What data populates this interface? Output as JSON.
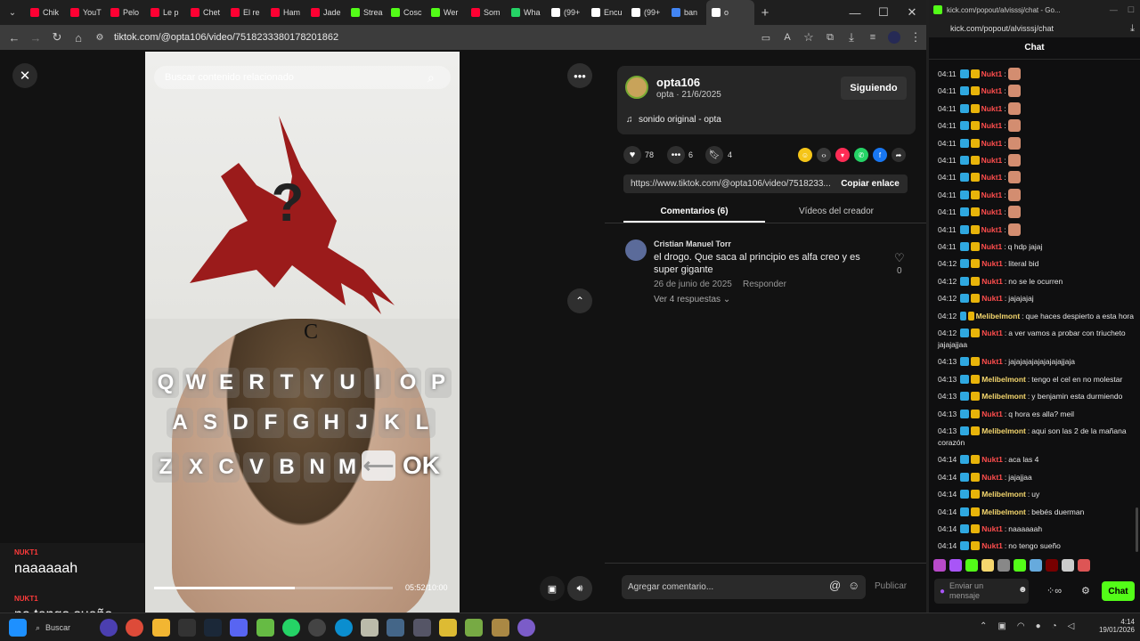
{
  "browser": {
    "tabs": [
      {
        "label": "Chik",
        "color": "#ff0033"
      },
      {
        "label": "YouT",
        "color": "#ff0033"
      },
      {
        "label": "Pelo",
        "color": "#ff0033"
      },
      {
        "label": "Le p",
        "color": "#ff0033"
      },
      {
        "label": "Chet",
        "color": "#ff0033"
      },
      {
        "label": "El re",
        "color": "#ff0033"
      },
      {
        "label": "Ham",
        "color": "#ff0033"
      },
      {
        "label": "Jade",
        "color": "#ff0033"
      },
      {
        "label": "Strea",
        "color": "#53fc18"
      },
      {
        "label": "Cosc",
        "color": "#53fc18"
      },
      {
        "label": "Wer",
        "color": "#53fc18"
      },
      {
        "label": "Som",
        "color": "#ff0033"
      },
      {
        "label": "Wha",
        "color": "#25d366"
      },
      {
        "label": "(99+",
        "color": "#ffffff"
      },
      {
        "label": "Encu",
        "color": "#ffffff"
      },
      {
        "label": "(99+",
        "color": "#ffffff"
      },
      {
        "label": "ban",
        "color": "#4285f4"
      },
      {
        "label": "o",
        "color": "#ffffff"
      }
    ],
    "new_tab": "+",
    "url": "tiktok.com/@opta106/video/7518233380178201862"
  },
  "video": {
    "search_placeholder": "Buscar contenido relacionado",
    "time": "05:52/10:00",
    "progress": 0.59,
    "letter": "C",
    "keyboard_rows": [
      [
        "Q",
        "W",
        "E",
        "R",
        "T",
        "Y",
        "U",
        "I",
        "O",
        "P"
      ],
      [
        "A",
        "S",
        "D",
        "F",
        "G",
        "H",
        "J",
        "K",
        "L"
      ],
      [
        "Z",
        "X",
        "C",
        "V",
        "B",
        "N",
        "M"
      ]
    ],
    "ok": "OK",
    "backspace": "⟵"
  },
  "overlay": {
    "user1": "NUKT1",
    "msg1": "naaaaaah",
    "user2": "NUKT1",
    "msg2": "no tengo sueño"
  },
  "creator": {
    "name": "opta106",
    "meta": "opta · 21/6/2025",
    "follow": "Siguiendo",
    "sound": "sonido original - opta"
  },
  "stats": {
    "likes": "78",
    "comments": "6",
    "saves": "4"
  },
  "share": {
    "link": "https://www.tiktok.com/@opta106/video/7518233...",
    "copy": "Copiar enlace",
    "icons": [
      {
        "name": "emoji",
        "color": "#f5c518"
      },
      {
        "name": "embed",
        "color": "#3a3a3a"
      },
      {
        "name": "send",
        "color": "#fe2c55"
      },
      {
        "name": "whatsapp",
        "color": "#25d366"
      },
      {
        "name": "facebook",
        "color": "#1877f2"
      },
      {
        "name": "share",
        "color": "#2f2f2f"
      }
    ]
  },
  "tabs": {
    "comments": "Comentarios (6)",
    "videos": "Vídeos del creador"
  },
  "comment": {
    "author": "Cristian Manuel Torr",
    "text": "el drogo. Que saca al principio es alfa creo y es super gigante",
    "date": "26 de junio de 2025",
    "reply": "Responder",
    "replies": "Ver 4 respuestas",
    "likes": "0"
  },
  "add_comment": {
    "placeholder": "Agregar comentario...",
    "publish": "Publicar"
  },
  "kick": {
    "url": "kick.com/popout/alvisssj/chat - Go...",
    "address": "kick.com/popout/alvisssj/chat",
    "title": "Chat",
    "messages": [
      {
        "t": "04:11",
        "u": "Nukt1",
        "c": "#ff4d4d",
        "m": "",
        "e": true
      },
      {
        "t": "04:11",
        "u": "Nukt1",
        "c": "#ff4d4d",
        "m": "",
        "e": true
      },
      {
        "t": "04:11",
        "u": "Nukt1",
        "c": "#ff4d4d",
        "m": "",
        "e": true
      },
      {
        "t": "04:11",
        "u": "Nukt1",
        "c": "#ff4d4d",
        "m": "",
        "e": true
      },
      {
        "t": "04:11",
        "u": "Nukt1",
        "c": "#ff4d4d",
        "m": "",
        "e": true
      },
      {
        "t": "04:11",
        "u": "Nukt1",
        "c": "#ff4d4d",
        "m": "",
        "e": true
      },
      {
        "t": "04:11",
        "u": "Nukt1",
        "c": "#ff4d4d",
        "m": "",
        "e": true
      },
      {
        "t": "04:11",
        "u": "Nukt1",
        "c": "#ff4d4d",
        "m": "",
        "e": true
      },
      {
        "t": "04:11",
        "u": "Nukt1",
        "c": "#ff4d4d",
        "m": "",
        "e": true
      },
      {
        "t": "04:11",
        "u": "Nukt1",
        "c": "#ff4d4d",
        "m": "",
        "e": true
      },
      {
        "t": "04:11",
        "u": "Nukt1",
        "c": "#ff4d4d",
        "m": "q hdp jajaj",
        "e": false
      },
      {
        "t": "04:12",
        "u": "Nukt1",
        "c": "#ff4d4d",
        "m": "literal bid",
        "e": false
      },
      {
        "t": "04:12",
        "u": "Nukt1",
        "c": "#ff4d4d",
        "m": "no se le ocurren",
        "e": false
      },
      {
        "t": "04:12",
        "u": "Nukt1",
        "c": "#ff4d4d",
        "m": "jajajajaj",
        "e": false
      },
      {
        "t": "04:12",
        "u": "Melibelmont",
        "c": "#f5d76e",
        "m": "que haces despierto a esta hora",
        "e": false
      },
      {
        "t": "04:12",
        "u": "Nukt1",
        "c": "#ff4d4d",
        "m": "a ver vamos a probar con triucheto",
        "m2": "jajajajjaa",
        "e": false
      },
      {
        "t": "04:13",
        "u": "Nukt1",
        "c": "#ff4d4d",
        "m": "jajajajajajajajajajjaja",
        "e": false
      },
      {
        "t": "04:13",
        "u": "Melibelmont",
        "c": "#f5d76e",
        "m": "tengo el cel en no molestar",
        "e": false
      },
      {
        "t": "04:13",
        "u": "Melibelmont",
        "c": "#f5d76e",
        "m": "y benjamin esta durmiendo",
        "e": false
      },
      {
        "t": "04:13",
        "u": "Nukt1",
        "c": "#ff4d4d",
        "m": "q hora es alla? meil",
        "e": false
      },
      {
        "t": "04:13",
        "u": "Melibelmont",
        "c": "#f5d76e",
        "m": "aqui son las 2 de la mañana",
        "m2": "corazón",
        "e": false
      },
      {
        "t": "04:14",
        "u": "Nukt1",
        "c": "#ff4d4d",
        "m": "aca las 4",
        "e": false
      },
      {
        "t": "04:14",
        "u": "Nukt1",
        "c": "#ff4d4d",
        "m": "jajajjaa",
        "e": false
      },
      {
        "t": "04:14",
        "u": "Melibelmont",
        "c": "#f5d76e",
        "m": "uy",
        "e": false
      },
      {
        "t": "04:14",
        "u": "Melibelmont",
        "c": "#f5d76e",
        "m": "bebés duerman",
        "e": false
      },
      {
        "t": "04:14",
        "u": "Nukt1",
        "c": "#ff4d4d",
        "m": "naaaaaah",
        "e": false
      },
      {
        "t": "04:14",
        "u": "Nukt1",
        "c": "#ff4d4d",
        "m": "no tengo sueño",
        "e": false
      }
    ],
    "send_placeholder": "Enviar un mensaje",
    "chat_button": "Chat",
    "accent": "#53fc18"
  },
  "taskbar": {
    "search": "Buscar",
    "time": "4:14",
    "date": "19/01/2026"
  }
}
